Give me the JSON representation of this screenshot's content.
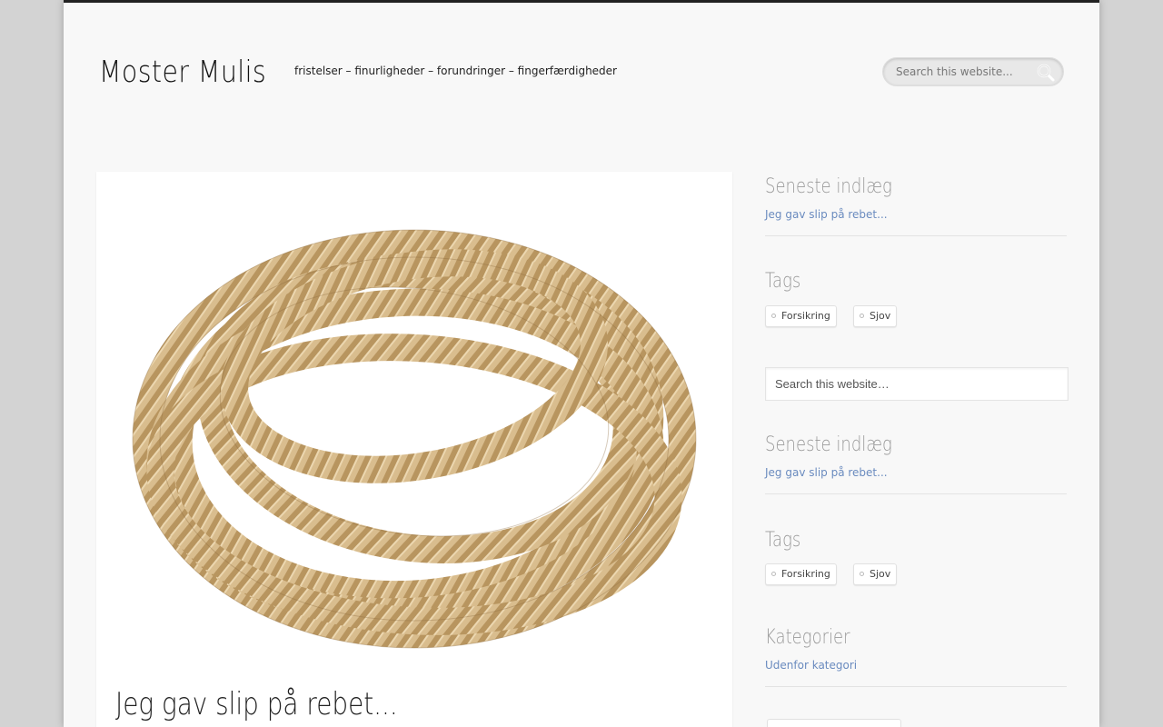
{
  "site": {
    "title": "Moster Mulis",
    "tagline": "fristelser – finurligheder – forundringer – fingerfærdigheder"
  },
  "header_search": {
    "placeholder": "Search this website...",
    "icon": "search-icon"
  },
  "post": {
    "image_alt": "rope",
    "title": "Jeg gav slip på rebet..."
  },
  "sidebar": {
    "widgets": [
      {
        "title": "Seneste indlæg",
        "links": [
          "Jeg gav slip på rebet..."
        ]
      },
      {
        "title": "Tags",
        "tags": [
          "Forsikring",
          "Sjov"
        ]
      },
      {
        "search_placeholder": "Search this website…"
      },
      {
        "title": "Seneste indlæg",
        "links": [
          "Jeg gav slip på rebet..."
        ]
      },
      {
        "title": "Tags",
        "tags": [
          "Forsikring",
          "Sjov"
        ]
      },
      {
        "title": "Kategorier",
        "links": [
          "Udenfor kategori"
        ]
      }
    ]
  },
  "colors": {
    "background": "#d3d3d3",
    "page": "#f8f8f8",
    "link": "#6a8bbf",
    "widget_title": "#9a9a9a",
    "rope": "#d2b48c"
  }
}
